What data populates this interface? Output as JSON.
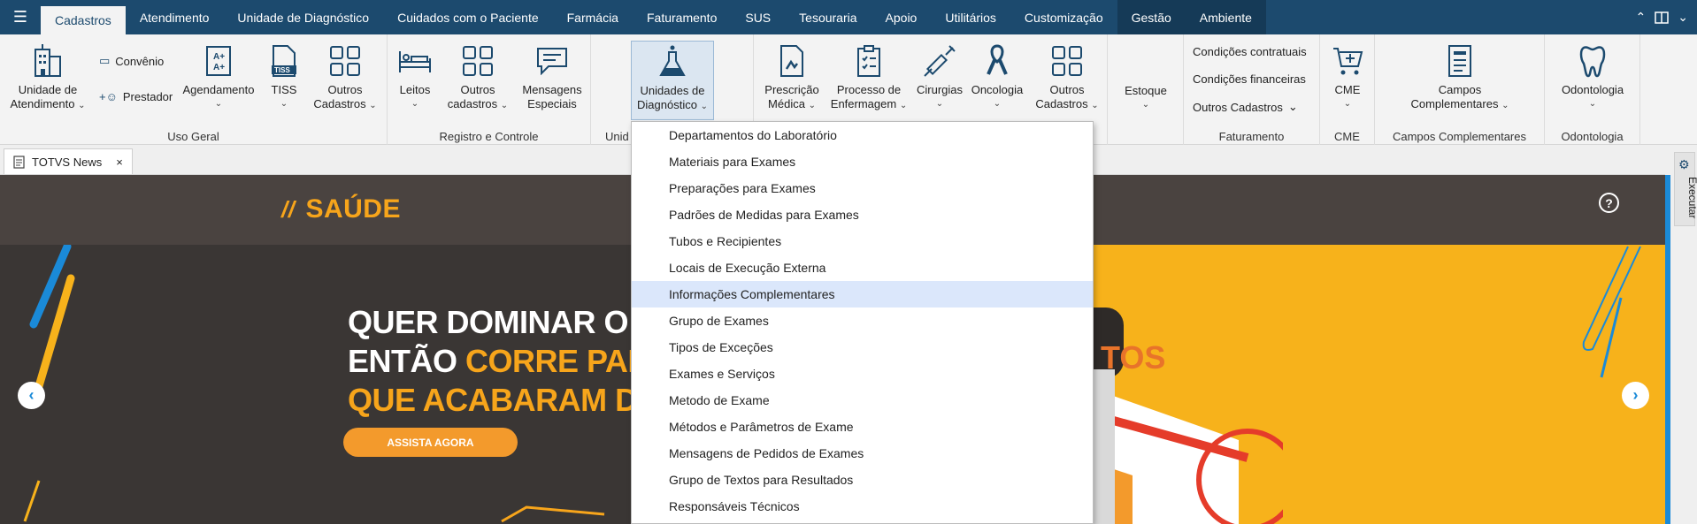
{
  "menubar": {
    "tabs": [
      "Cadastros",
      "Atendimento",
      "Unidade de Diagnóstico",
      "Cuidados com o Paciente",
      "Farmácia",
      "Faturamento",
      "SUS",
      "Tesouraria",
      "Apoio",
      "Utilitários",
      "Customização",
      "Gestão",
      "Ambiente"
    ],
    "right_icons": [
      "chevron-up-icon",
      "layout-icon",
      "chevron-down-icon"
    ]
  },
  "ribbon": {
    "uso_geral": {
      "label": "Uso Geral",
      "unidade": {
        "line1": "Unidade de",
        "line2": "Atendimento"
      },
      "convenio": "Convênio",
      "prestador": "Prestador",
      "agendamento": "Agendamento",
      "tiss": "TISS",
      "outros": {
        "line1": "Outros",
        "line2": "Cadastros"
      }
    },
    "registro": {
      "label": "Registro e Controle",
      "leitos": "Leitos",
      "outros": {
        "line1": "Outros",
        "line2": "cadastros"
      },
      "mensagens": {
        "line1": "Mensagens",
        "line2": "Especiais"
      }
    },
    "unidades": {
      "label_partial": "Unid",
      "btn": {
        "line1": "Unidades de",
        "line2": "Diagnóstico"
      }
    },
    "assist": {
      "prescricao": {
        "line1": "Prescrição",
        "line2": "Médica"
      },
      "processo": {
        "line1": "Processo de",
        "line2": "Enfermagem"
      },
      "cirurgias": "Cirurgias",
      "oncologia": "Oncologia",
      "outros": {
        "line1": "Outros",
        "line2": "Cadastros"
      }
    },
    "estoque": {
      "btn": "Estoque"
    },
    "faturamento": {
      "label": "Faturamento",
      "items": [
        "Condições contratuais",
        "Condições financeiras",
        "Outros Cadastros"
      ]
    },
    "cme": {
      "label": "CME",
      "btn": "CME"
    },
    "campos": {
      "label": "Campos Complementares",
      "btn": {
        "line1": "Campos",
        "line2": "Complementares"
      }
    },
    "odonto": {
      "label": "Odontologia",
      "btn": "Odontologia"
    }
  },
  "doc_tab": {
    "title": "TOTVS News",
    "close": "×"
  },
  "banner": {
    "logo": "SAÚDE",
    "logo_mark": "//",
    "line1": "QUER DOMINAR O",
    "line2_white": "ENTÃO ",
    "line2_orange": "CORRE PAR",
    "line3": "QUE ACABARAM D",
    "tos": "TOS",
    "cta": "ASSISTA AGORA",
    "prev": "‹",
    "next": "›",
    "help": "?"
  },
  "side": {
    "exec": "Executar"
  },
  "dropdown": {
    "items": [
      "Departamentos do Laboratório",
      "Materiais para Exames",
      "Preparações para Exames",
      "Padrões de Medidas para Exames",
      "Tubos e Recipientes",
      "Locais de Execução Externa",
      "Informações Complementares",
      "Grupo de Exames",
      "Tipos de Exceções",
      "Exames e Serviços",
      "Metodo de Exame",
      "Métodos e Parâmetros de Exame",
      "Mensagens de Pedidos de Exames",
      "Grupo de Textos para Resultados",
      "Responsáveis Técnicos"
    ],
    "highlighted_index": 6
  },
  "colors": {
    "menubar": "#1c4a6e",
    "accent": "#1a8ad8",
    "orange": "#f7a51b",
    "yellow": "#f7b21b"
  }
}
